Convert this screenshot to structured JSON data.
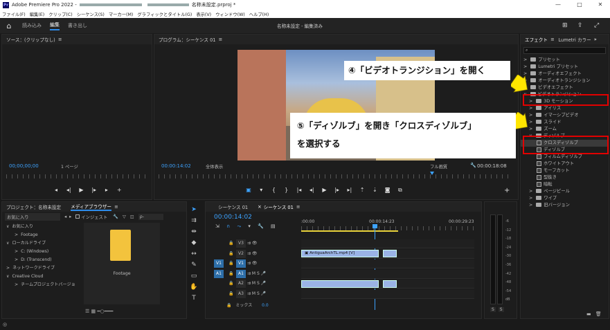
{
  "titlebar": {
    "app_label": "Pr",
    "title": "Adobe Premiere Pro 2022 - ",
    "title_suffix": "名称未設定.prproj *",
    "min": "—",
    "max": "□",
    "close": "✕"
  },
  "menu": [
    "ファイル(F)",
    "編集(E)",
    "クリップ(C)",
    "シーケンス(S)",
    "マーカー(M)",
    "グラフィックとタイトル(G)",
    "表示(V)",
    "ウィンドウ(W)",
    "ヘルプ(H)"
  ],
  "workspace": {
    "tabs": [
      "読み込み",
      "編集",
      "書き出し"
    ],
    "active": "編集",
    "project_title": "名称未設定 - 編集済み"
  },
  "source_monitor": {
    "title": "ソース：(クリップなし)",
    "timecode": "00;00;00;00",
    "page": "1 ページ"
  },
  "program_monitor": {
    "title": "プログラム：シーケンス 01",
    "timecode": "00:00:14:02",
    "fit": "全体表示",
    "quality": "フル画質",
    "duration": "00:00:18:08"
  },
  "project_panel": {
    "tab1": "プロジェクト：名称未設定",
    "tab2": "メディアブラウザー",
    "favorites_label": "お気に入り",
    "ingest": "インジェスト",
    "search_placeholder": "ρ-",
    "tree": [
      {
        "label": "お気に入り",
        "indent": 0,
        "arrow": "∨"
      },
      {
        "label": "Footage",
        "indent": 2,
        "arrow": ">"
      },
      {
        "label": "ローカルドライブ",
        "indent": 0,
        "arrow": "∨"
      },
      {
        "label": "C: (Windows)",
        "indent": 2,
        "arrow": ">"
      },
      {
        "label": "D: (Transcend)",
        "indent": 2,
        "arrow": ">"
      },
      {
        "label": "ネットワークドライブ",
        "indent": 0,
        "arrow": ">"
      },
      {
        "label": "Creative Cloud",
        "indent": 0,
        "arrow": "∨"
      },
      {
        "label": "チームプロジェクトバージョ",
        "indent": 2,
        "arrow": ">"
      }
    ],
    "folder_thumb_label": "Footage"
  },
  "timeline": {
    "tab1": "シーケンス 01",
    "tab2": "シーケンス 01",
    "timecode": "00:00:14:02",
    "ruler": [
      ":00:00",
      "00:00:14:23",
      "00:00:29:23"
    ],
    "tracks": [
      {
        "name": "V3",
        "src": "",
        "type": "video"
      },
      {
        "name": "V2",
        "src": "",
        "type": "video"
      },
      {
        "name": "V1",
        "src": "V1",
        "type": "video"
      },
      {
        "name": "A1",
        "src": "A1",
        "type": "audio"
      },
      {
        "name": "A2",
        "src": "",
        "type": "audio"
      },
      {
        "name": "A3",
        "src": "",
        "type": "audio"
      }
    ],
    "mix_label": "ミックス",
    "mix_value": "0.0",
    "clip_label": "AntiguaArchTL.mp4 [V]"
  },
  "effects_panel": {
    "tab1": "エフェクト",
    "tab2": "Lumetri カラー",
    "items": [
      {
        "label": "プリセット",
        "level": 0
      },
      {
        "label": "Lumetri プリセット",
        "level": 0
      },
      {
        "label": "オーディオエフェクト",
        "level": 0
      },
      {
        "label": "オーディオトランジション",
        "level": 0
      },
      {
        "label": "ビデオエフェクト",
        "level": 0
      },
      {
        "label": "ビデオトランジション",
        "level": 0,
        "open": true
      },
      {
        "label": "3D モーション",
        "level": 1
      },
      {
        "label": "アイリス",
        "level": 1
      },
      {
        "label": "イマーシブビデオ",
        "level": 1
      },
      {
        "label": "スライド",
        "level": 1
      },
      {
        "label": "ズーム",
        "level": 1
      },
      {
        "label": "ディゾルブ",
        "level": 1,
        "open": true
      },
      {
        "label": "クロスディゾルブ",
        "level": 2,
        "selected": true
      },
      {
        "label": "ディゾルブ",
        "level": 2
      },
      {
        "label": "フィルムディゾルブ",
        "level": 2
      },
      {
        "label": "ホワイトアウト",
        "level": 2
      },
      {
        "label": "モーフカット",
        "level": 2
      },
      {
        "label": "型抜き",
        "level": 2
      },
      {
        "label": "暗転",
        "level": 2
      },
      {
        "label": "ページピール",
        "level": 1
      },
      {
        "label": "ワイプ",
        "level": 1
      },
      {
        "label": "旧バージョン",
        "level": 1
      }
    ]
  },
  "audio_meter": {
    "scale": [
      "-6",
      "-12",
      "-18",
      "-24",
      "-30",
      "-36",
      "-42",
      "-48",
      "-54",
      "dB"
    ],
    "solo": [
      "S",
      "S"
    ]
  },
  "callouts": {
    "step4": "④「ビデオトランジション」を開く",
    "step5_line1": "⑤「ディゾルブ」を開き「クロスディゾルブ」",
    "step5_line2": "を選択する"
  },
  "colors": {
    "accent_blue": "#2d8ceb",
    "highlight_red": "#e20000",
    "arrow_yellow": "#ffe600",
    "clip_blue": "#9ab3e6"
  }
}
